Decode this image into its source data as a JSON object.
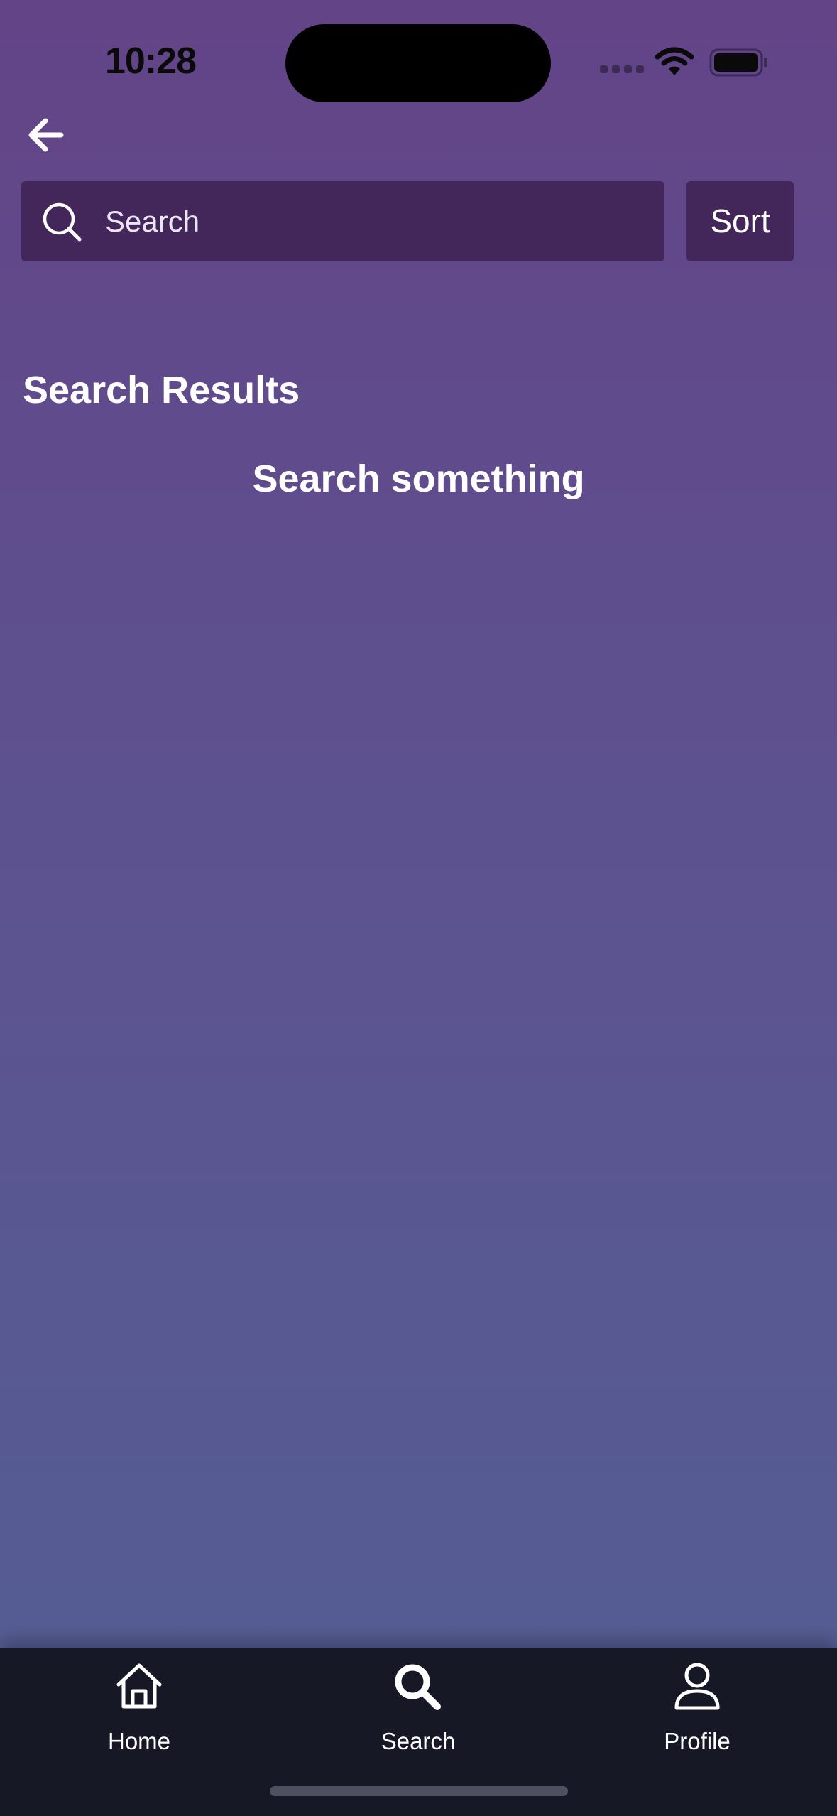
{
  "status_bar": {
    "time": "10:28",
    "icons": [
      "cellular-signal-icon",
      "wifi-icon",
      "battery-icon"
    ]
  },
  "header": {
    "back_icon": "arrow-left-icon"
  },
  "search": {
    "placeholder": "Search",
    "value": "",
    "icon": "search-icon",
    "sort_label": "Sort"
  },
  "main": {
    "results_title": "Search Results",
    "empty_message": "Search something"
  },
  "tab_bar": {
    "active": "Search",
    "tabs": [
      {
        "label": "Home",
        "icon": "home-icon"
      },
      {
        "label": "Search",
        "icon": "search-icon"
      },
      {
        "label": "Profile",
        "icon": "profile-icon"
      }
    ]
  },
  "colors": {
    "background_top": "#634487",
    "background_bottom": "#535f94",
    "search_field": "#43265a",
    "tab_bar": "#161826",
    "text": "#ffffff"
  }
}
